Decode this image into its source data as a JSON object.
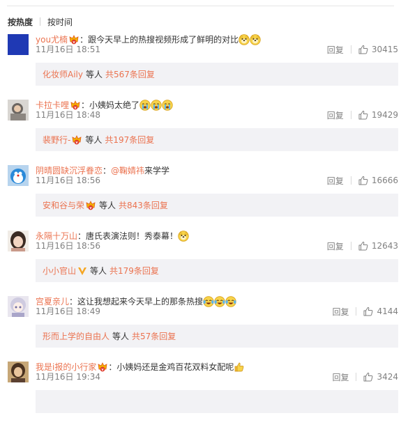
{
  "sort": {
    "by_hot": "按热度",
    "by_time": "按时间"
  },
  "comments": [
    {
      "user": "you尤楠",
      "vip": true,
      "text_prefix": "：跟今天早上的热搜视频形成了鲜明的对比",
      "mention": "",
      "text_suffix": "",
      "emojis": [
        "doge-emoji",
        "doge-emoji"
      ],
      "date": "11月16日",
      "time": "18:51",
      "reply_label": "回复",
      "likes": "30415",
      "sub_user": "化妆师Aily",
      "sub_vbadge": false,
      "sub_vip": false,
      "sub_suffix": "等人",
      "sub_count": "共567条回复"
    },
    {
      "user": "卡拉卡哩",
      "vip": true,
      "text_prefix": "：小姨妈太绝了",
      "mention": "",
      "text_suffix": "",
      "emojis": [
        "crying-emoji",
        "crying-emoji",
        "crying-emoji"
      ],
      "date": "11月16日",
      "time": "18:48",
      "reply_label": "回复",
      "likes": "19429",
      "sub_user": "裴野行-",
      "sub_vbadge": false,
      "sub_vip": true,
      "sub_suffix": "等人",
      "sub_count": "共197条回复"
    },
    {
      "user": "阴晴圆缺沉浮眷恋",
      "vip": false,
      "text_prefix": "：",
      "mention": "@鞠婧祎",
      "text_suffix": " 来学学",
      "emojis": [],
      "date": "11月16日",
      "time": "18:56",
      "reply_label": "回复",
      "likes": "16666",
      "sub_user": "安和谷与荣",
      "sub_vbadge": false,
      "sub_vip": true,
      "sub_suffix": "等人",
      "sub_count": "共843条回复"
    },
    {
      "user": "永隔十万山",
      "vip": false,
      "text_prefix": "：唐氏表演法则！秀泰幕！",
      "mention": "",
      "text_suffix": "",
      "emojis": [
        "doge-emoji"
      ],
      "date": "11月16日",
      "time": "18:56",
      "reply_label": "回复",
      "likes": "12643",
      "sub_user": "小小官山",
      "sub_vbadge": true,
      "sub_vip": false,
      "sub_suffix": "等人",
      "sub_count": "共179条回复"
    },
    {
      "user": "宫夏亲儿",
      "vip": false,
      "text_prefix": "：这让我想起来今天早上的那条热搜",
      "mention": "",
      "text_suffix": "",
      "emojis": [
        "laugh-cry-emoji",
        "laugh-cry-emoji",
        "laugh-cry-emoji"
      ],
      "date": "11月16日",
      "time": "18:49",
      "reply_label": "回复",
      "likes": "4144",
      "sub_user": "形而上学的自由人",
      "sub_vbadge": false,
      "sub_vip": false,
      "sub_suffix": "等人",
      "sub_count": "共57条回复"
    },
    {
      "user": "我是i报的小行家",
      "vip": true,
      "text_prefix": "：小姨妈还是金鸡百花双料女配呢",
      "mention": "",
      "text_suffix": "",
      "emojis": [
        "thumbs-up-emoji"
      ],
      "date": "11月16日",
      "time": "19:34",
      "reply_label": "回复",
      "likes": "3424",
      "sub_user": "",
      "sub_vbadge": false,
      "sub_vip": false,
      "sub_suffix": "",
      "sub_count": ""
    }
  ],
  "colors": {
    "username": "#eb7350",
    "meta": "#808080",
    "subbox_bg": "#f2f2f5",
    "text": "#333333"
  }
}
